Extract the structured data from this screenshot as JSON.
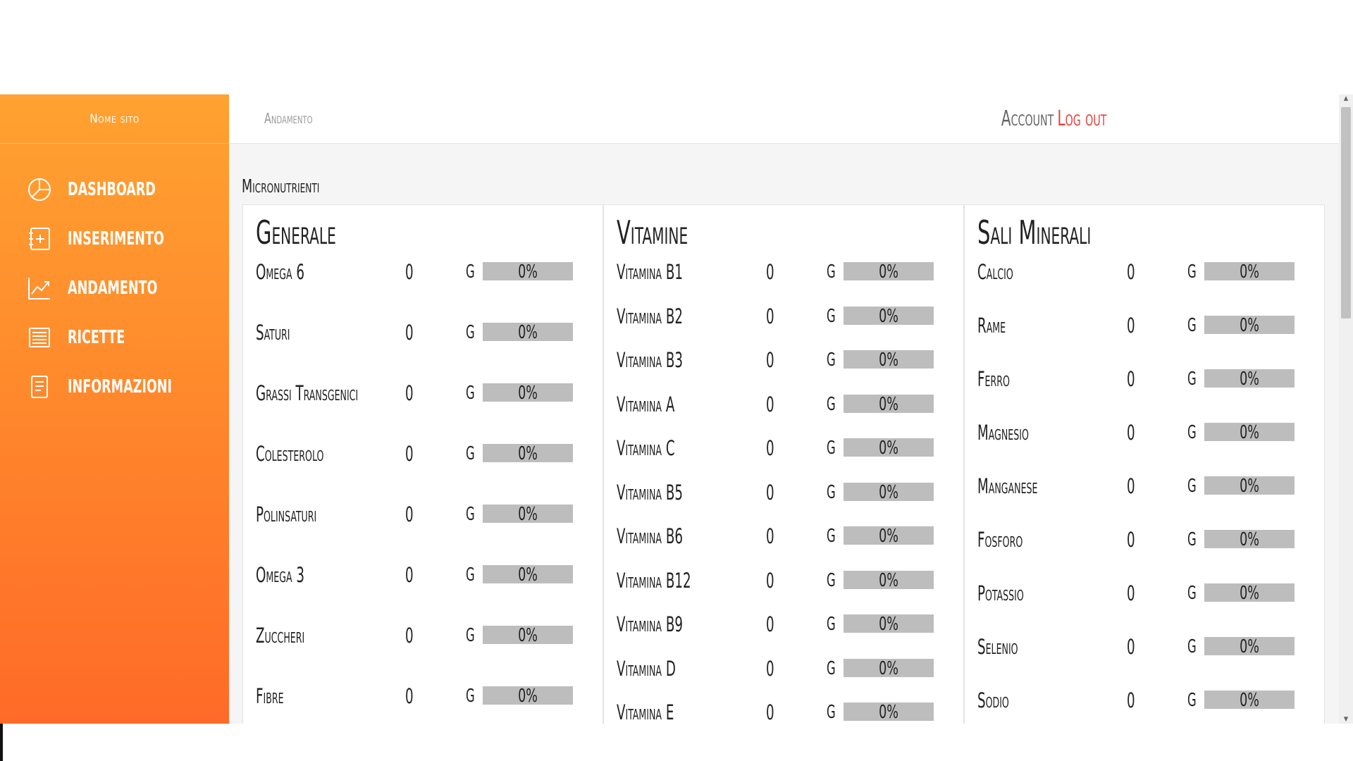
{
  "sidebar": {
    "brand": "Nome sito",
    "items": [
      {
        "label": "Dashboard",
        "icon": "pie-chart-icon"
      },
      {
        "label": "Inserimento",
        "icon": "add-list-icon"
      },
      {
        "label": "Andamento",
        "icon": "line-chart-icon"
      },
      {
        "label": "Ricette",
        "icon": "receipt-icon"
      },
      {
        "label": "Informazioni",
        "icon": "document-icon"
      }
    ]
  },
  "header": {
    "breadcrumb": "Andamento",
    "account": "Account",
    "logout": "Log out",
    "logout_color": "#e8413b"
  },
  "main": {
    "section_title": "Micronutrienti",
    "panels": [
      {
        "title": "Generale",
        "rows": [
          {
            "name": "Omega 6",
            "value": "0",
            "unit": "G",
            "percent": "0%"
          },
          {
            "name": "Saturi",
            "value": "0",
            "unit": "G",
            "percent": "0%"
          },
          {
            "name": "Grassi Transgenici",
            "value": "0",
            "unit": "G",
            "percent": "0%"
          },
          {
            "name": "Colesterolo",
            "value": "0",
            "unit": "G",
            "percent": "0%"
          },
          {
            "name": "Polinsaturi",
            "value": "0",
            "unit": "G",
            "percent": "0%"
          },
          {
            "name": "Omega 3",
            "value": "0",
            "unit": "G",
            "percent": "0%"
          },
          {
            "name": "Zuccheri",
            "value": "0",
            "unit": "G",
            "percent": "0%"
          },
          {
            "name": "Fibre",
            "value": "0",
            "unit": "G",
            "percent": "0%"
          }
        ]
      },
      {
        "title": "Vitamine",
        "rows": [
          {
            "name": "Vitamina B1",
            "value": "0",
            "unit": "G",
            "percent": "0%"
          },
          {
            "name": "Vitamina B2",
            "value": "0",
            "unit": "G",
            "percent": "0%"
          },
          {
            "name": "Vitamina B3",
            "value": "0",
            "unit": "G",
            "percent": "0%"
          },
          {
            "name": "Vitamina A",
            "value": "0",
            "unit": "G",
            "percent": "0%"
          },
          {
            "name": "Vitamina C",
            "value": "0",
            "unit": "G",
            "percent": "0%"
          },
          {
            "name": "Vitamina B5",
            "value": "0",
            "unit": "G",
            "percent": "0%"
          },
          {
            "name": "Vitamina B6",
            "value": "0",
            "unit": "G",
            "percent": "0%"
          },
          {
            "name": "Vitamina B12",
            "value": "0",
            "unit": "G",
            "percent": "0%"
          },
          {
            "name": "Vitamina B9",
            "value": "0",
            "unit": "G",
            "percent": "0%"
          },
          {
            "name": "Vitamina D",
            "value": "0",
            "unit": "G",
            "percent": "0%"
          },
          {
            "name": "Vitamina E",
            "value": "0",
            "unit": "G",
            "percent": "0%"
          }
        ]
      },
      {
        "title": "Sali Minerali",
        "rows": [
          {
            "name": "Calcio",
            "value": "0",
            "unit": "G",
            "percent": "0%"
          },
          {
            "name": "Rame",
            "value": "0",
            "unit": "G",
            "percent": "0%"
          },
          {
            "name": "Ferro",
            "value": "0",
            "unit": "G",
            "percent": "0%"
          },
          {
            "name": "Magnesio",
            "value": "0",
            "unit": "G",
            "percent": "0%"
          },
          {
            "name": "Manganese",
            "value": "0",
            "unit": "G",
            "percent": "0%"
          },
          {
            "name": "Fosforo",
            "value": "0",
            "unit": "G",
            "percent": "0%"
          },
          {
            "name": "Potassio",
            "value": "0",
            "unit": "G",
            "percent": "0%"
          },
          {
            "name": "Selenio",
            "value": "0",
            "unit": "G",
            "percent": "0%"
          },
          {
            "name": "Sodio",
            "value": "0",
            "unit": "G",
            "percent": "0%"
          }
        ]
      }
    ]
  },
  "colors": {
    "sidebar_top": "#ffa231",
    "sidebar_bottom": "#ff6a28",
    "bar_track": "#bdbdbd"
  }
}
